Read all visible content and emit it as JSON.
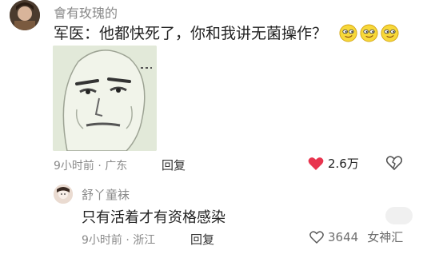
{
  "comment": {
    "username": "會有玫瑰的",
    "text": "军医：他都快死了，你和我讲无菌操作？",
    "emojis": [
      "smirk-emoji",
      "smirk-emoji",
      "smirk-emoji"
    ],
    "meta": "9小时前 · 广东",
    "reply_label": "回复",
    "likes": "2.6万",
    "like_color": "#e8344e"
  },
  "reply": {
    "username": "舒丫童袜",
    "text": "只有活着才有资格感染",
    "meta": "9小时前 · 浙江",
    "reply_label": "回复"
  },
  "watermark": {
    "count": "3644",
    "text": "女神汇"
  }
}
